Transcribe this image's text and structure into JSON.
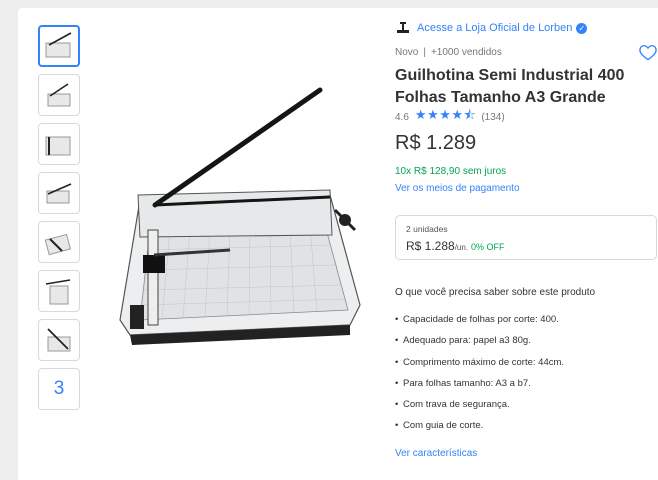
{
  "store": {
    "label": "Acesse a Loja Oficial de Lorben",
    "logo_icon": "lorben-logo-icon",
    "verified_icon": "verified-check-icon"
  },
  "product": {
    "condition": "Novo",
    "separator": "|",
    "sold": "+1000 vendidos",
    "title": "Guilhotina Semi Industrial 400 Folhas Tamanho A3 Grande",
    "rating_value": "4.6",
    "rating_stars": "★★★★⯪",
    "rating_stars_count": 4.6,
    "reviews": "(134)",
    "price": "R$ 1.289",
    "installments": "10x R$ 128,90 sem juros",
    "payment_link": "Ver os meios de pagamento"
  },
  "promo": {
    "units": "2 unidades",
    "price": "R$ 1.288",
    "unit_label": "/un.",
    "off": "0% OFF"
  },
  "features": {
    "title": "O que você precisa saber sobre este produto",
    "items": [
      "Capacidade de folhas por corte: 400.",
      "Adequado para: papel a3 80g.",
      "Comprimento máximo de corte: 44cm.",
      "Para folhas tamanho: A3 a b7.",
      "Com trava de segurança.",
      "Com guia de corte."
    ],
    "bullet": "•",
    "link": "Ver características"
  },
  "gallery": {
    "more_count": "3",
    "selected_index": 0
  },
  "colors": {
    "accent": "#3483fa",
    "green": "#00a650",
    "text": "#333333",
    "muted": "#777777"
  }
}
